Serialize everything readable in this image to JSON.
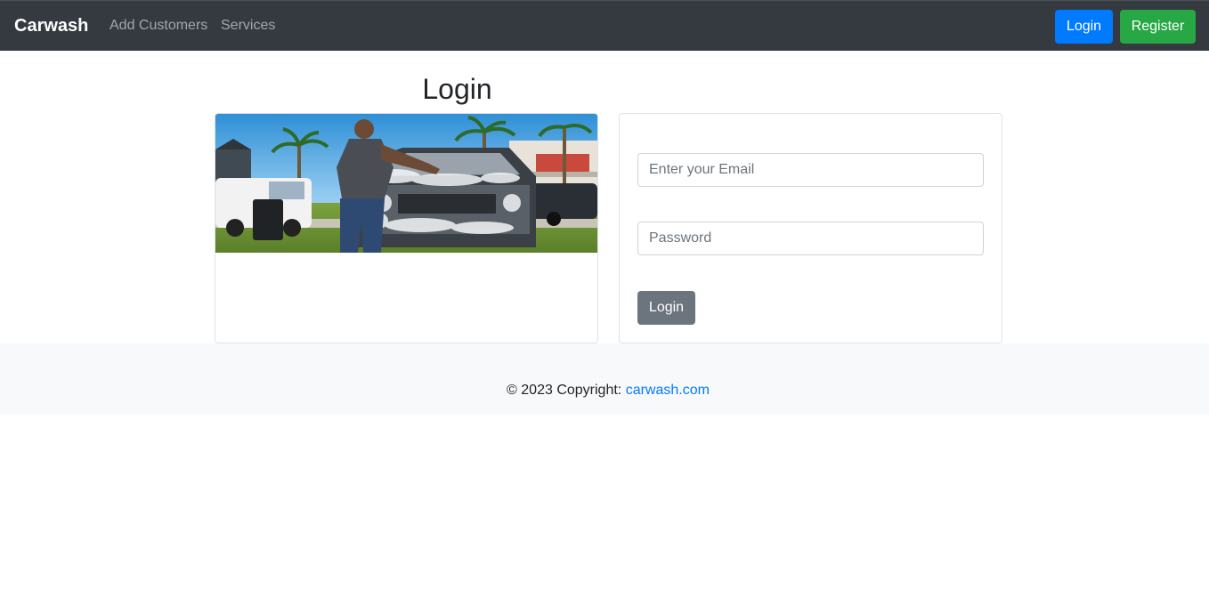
{
  "navbar": {
    "brand": "Carwash",
    "links": [
      "Add Customers",
      "Services"
    ],
    "login_label": "Login",
    "register_label": "Register"
  },
  "main": {
    "title": "Login",
    "image": {
      "alt": "Man washing a car covered in foam"
    },
    "form": {
      "email_placeholder": "Enter your Email",
      "email_value": "",
      "password_placeholder": "Password",
      "password_value": "",
      "submit_label": "Login"
    }
  },
  "footer": {
    "copyright": "© 2023 Copyright: ",
    "link_text": "carwash.com"
  },
  "colors": {
    "navbar_bg": "#343a40",
    "primary": "#007bff",
    "success": "#28a745",
    "secondary": "#6c757d",
    "footer_bg": "#f8f9fa"
  }
}
